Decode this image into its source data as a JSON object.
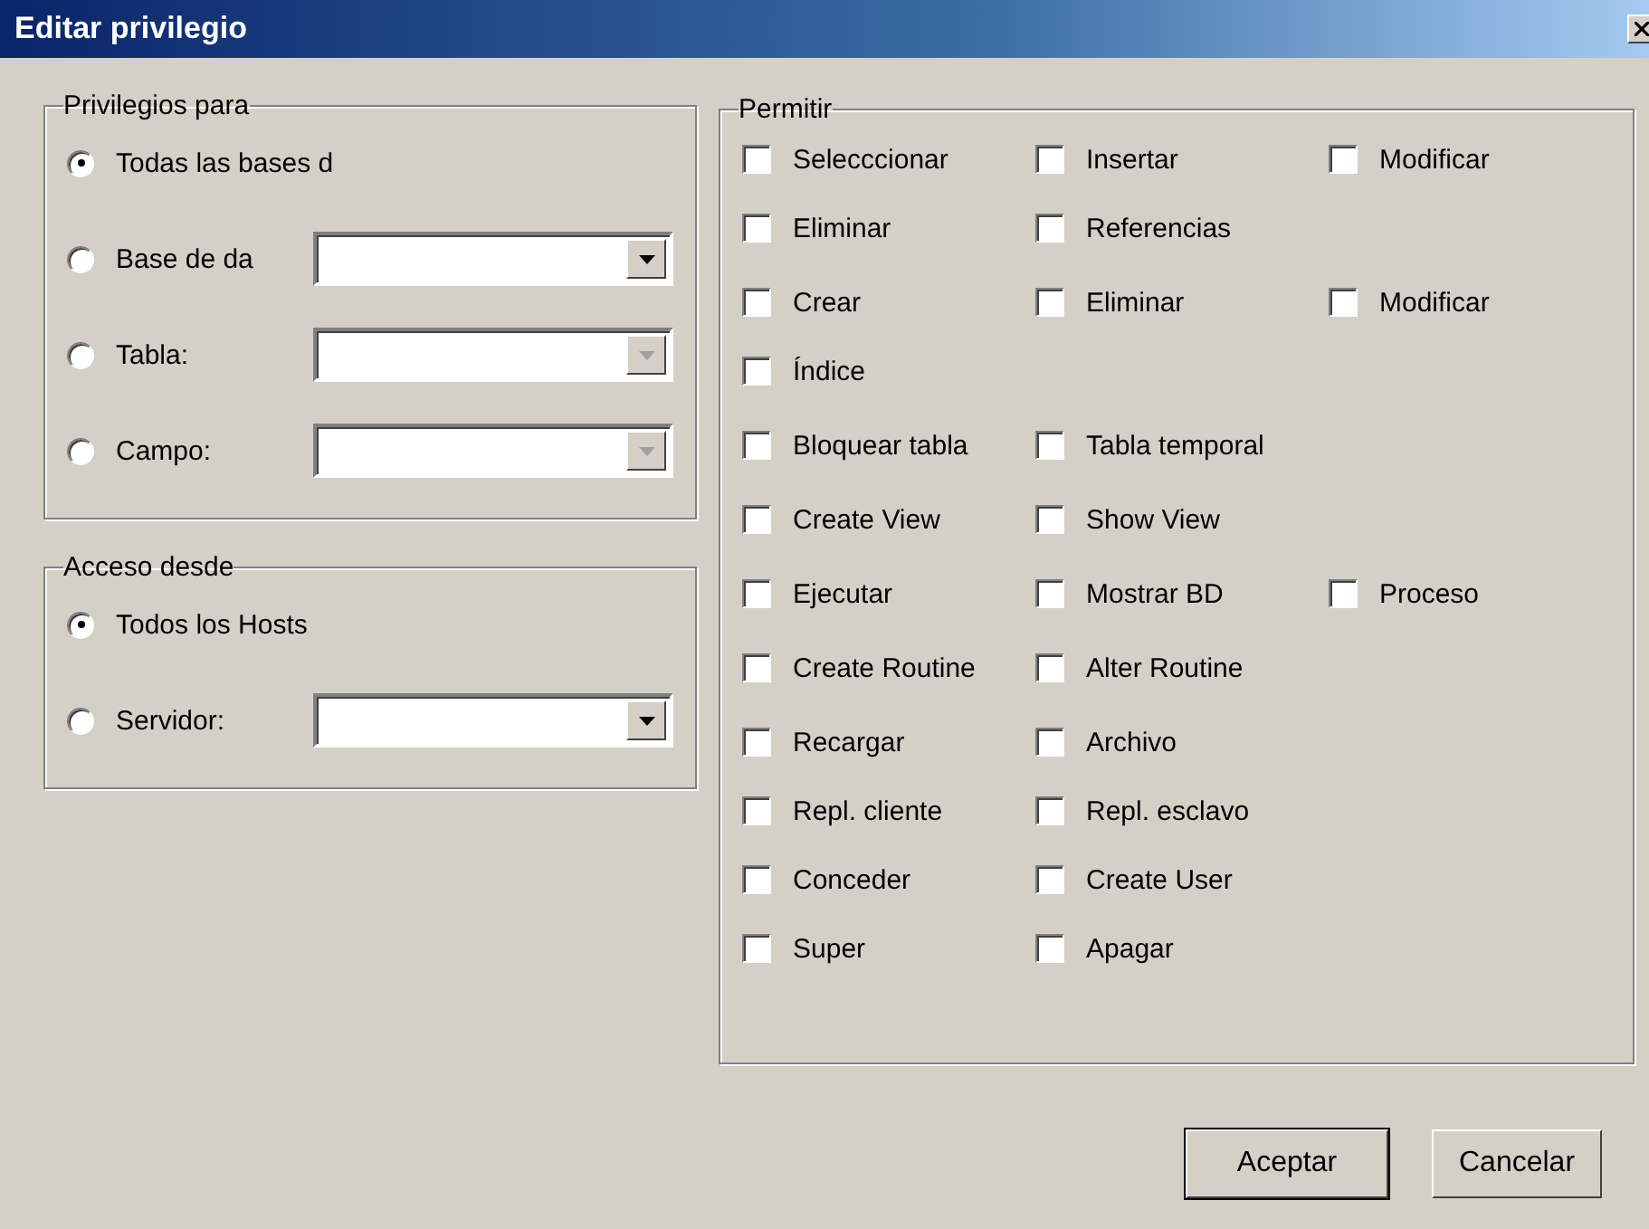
{
  "window": {
    "title": "Editar privilegio"
  },
  "privileges_for": {
    "title": "Privilegios para",
    "options": [
      {
        "label": "Todas las bases d",
        "selected": true
      },
      {
        "label": "Base de da",
        "selected": false,
        "combo": {
          "disabled": false
        }
      },
      {
        "label": "Tabla:",
        "selected": false,
        "combo": {
          "disabled": true
        }
      },
      {
        "label": "Campo:",
        "selected": false,
        "combo": {
          "disabled": true
        }
      }
    ]
  },
  "access_from": {
    "title": "Acceso desde",
    "options": [
      {
        "label": "Todos los Hosts",
        "selected": true
      },
      {
        "label": "Servidor:",
        "selected": false,
        "combo": {
          "disabled": false
        }
      }
    ]
  },
  "permissions": {
    "title": "Permitir",
    "groups": [
      {
        "rows": [
          [
            {
              "label": "Selecccionar",
              "checked": false
            },
            {
              "label": "Insertar",
              "checked": false
            },
            {
              "label": "Modificar",
              "checked": false
            }
          ],
          [
            {
              "label": "Eliminar",
              "checked": false
            },
            {
              "label": "Referencias",
              "checked": false
            }
          ]
        ]
      },
      {
        "rows": [
          [
            {
              "label": "Crear",
              "checked": false
            },
            {
              "label": "Eliminar",
              "checked": false
            },
            {
              "label": "Modificar",
              "checked": false
            }
          ],
          [
            {
              "label": "Índice",
              "checked": false
            }
          ]
        ]
      },
      {
        "rows": [
          [
            {
              "label": "Bloquear tabla",
              "checked": false
            },
            {
              "label": "Tabla temporal",
              "checked": false
            }
          ]
        ]
      },
      {
        "rows": [
          [
            {
              "label": "Create View",
              "checked": false
            },
            {
              "label": "Show View",
              "checked": false
            }
          ]
        ]
      },
      {
        "rows": [
          [
            {
              "label": "Ejecutar",
              "checked": false
            },
            {
              "label": "Mostrar BD",
              "checked": false
            },
            {
              "label": "Proceso",
              "checked": false
            }
          ]
        ]
      },
      {
        "rows": [
          [
            {
              "label": "Create Routine",
              "checked": false
            },
            {
              "label": "Alter Routine",
              "checked": false
            }
          ]
        ]
      },
      {
        "rows": [
          [
            {
              "label": "Recargar",
              "checked": false
            },
            {
              "label": "Archivo",
              "checked": false
            }
          ],
          [
            {
              "label": "Repl. cliente",
              "checked": false
            },
            {
              "label": "Repl. esclavo",
              "checked": false
            }
          ],
          [
            {
              "label": "Conceder",
              "checked": false
            },
            {
              "label": "Create User",
              "checked": false
            }
          ],
          [
            {
              "label": "Super",
              "checked": false
            },
            {
              "label": "Apagar",
              "checked": false
            }
          ]
        ]
      }
    ]
  },
  "buttons": [
    {
      "label": "Aceptar",
      "default": true
    },
    {
      "label": "Cancelar",
      "default": false
    }
  ]
}
